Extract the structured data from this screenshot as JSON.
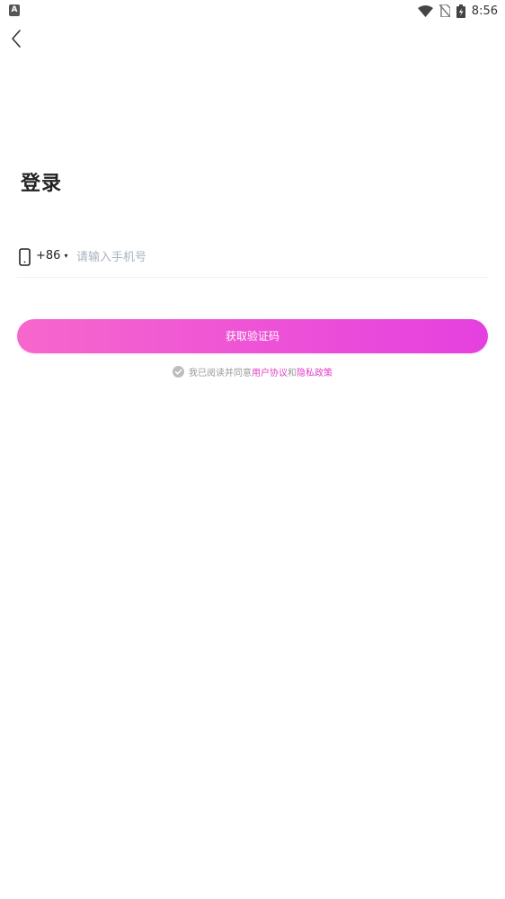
{
  "status_bar": {
    "left_badge": "A",
    "time": "8:56"
  },
  "title": "登录",
  "phone": {
    "country_code": "+86",
    "dropdown_caret": "▾",
    "placeholder": "请输入手机号",
    "value": ""
  },
  "button": {
    "get_code_label": "获取验证码"
  },
  "agreement": {
    "prefix": "我已阅读并同意",
    "user_agreement": "用户协议",
    "conjunction": "和",
    "privacy_policy": "隐私政策",
    "checked": true
  },
  "colors": {
    "accent_start": "#f667cc",
    "accent_end": "#e540df",
    "link": "#e03fc5",
    "placeholder": "#aab3c0"
  },
  "icons": {
    "back": "chevron-left-icon",
    "phone": "phone-icon",
    "check": "check-circle-icon",
    "wifi": "wifi-icon",
    "no_sim": "no-sim-icon",
    "battery": "battery-charging-icon"
  }
}
